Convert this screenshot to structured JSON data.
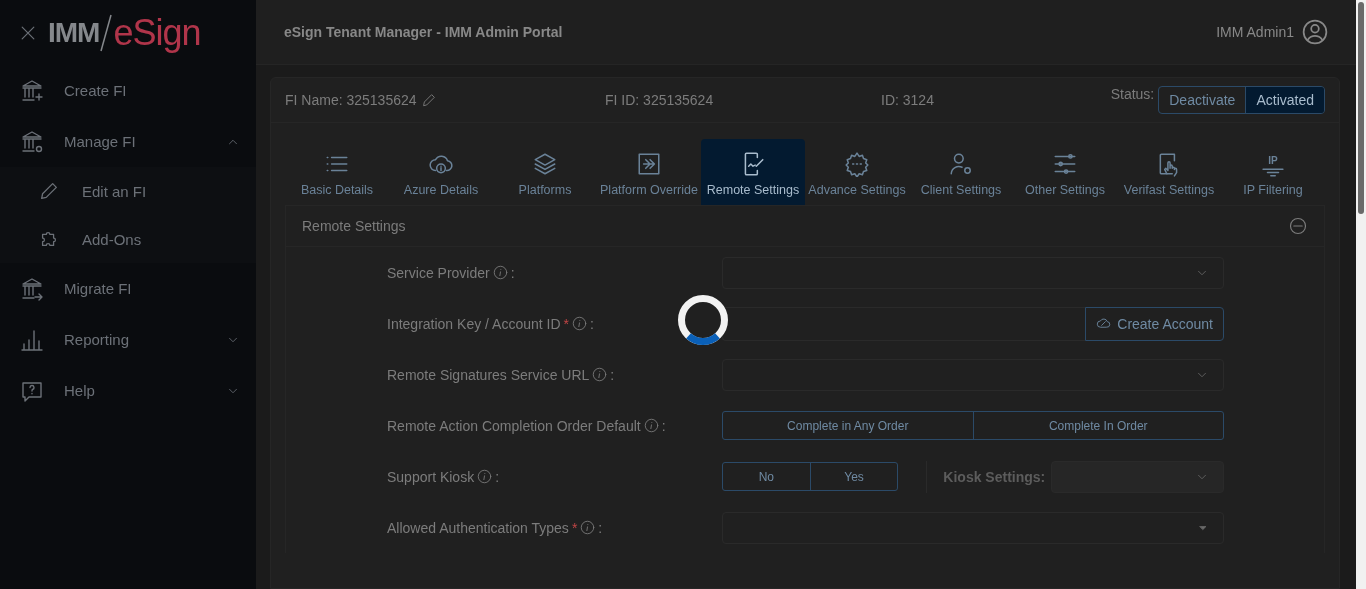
{
  "sidebar": {
    "logo": {
      "prefix": "IMM",
      "suffix": "eSign"
    },
    "items": [
      {
        "label": "Create FI",
        "kind": "link"
      },
      {
        "label": "Manage FI",
        "kind": "group",
        "expanded": true,
        "children": [
          {
            "label": "Edit an FI"
          },
          {
            "label": "Add-Ons"
          }
        ]
      },
      {
        "label": "Migrate FI",
        "kind": "link"
      },
      {
        "label": "Reporting",
        "kind": "group",
        "expanded": false
      },
      {
        "label": "Help",
        "kind": "group",
        "expanded": false
      }
    ]
  },
  "header": {
    "title": "eSign Tenant Manager - IMM Admin Portal",
    "user": "IMM Admin1"
  },
  "fi_info": {
    "fi_name": "FI Name: 325135624",
    "fi_id": "FI ID: 325135624",
    "id": "ID: 3124",
    "status_label": "Status:",
    "status_options": [
      {
        "label": "Deactivate",
        "selected": false
      },
      {
        "label": "Activated",
        "selected": true
      }
    ]
  },
  "tabs": [
    {
      "label": "Basic Details",
      "selected": false
    },
    {
      "label": "Azure Details",
      "selected": false
    },
    {
      "label": "Platforms",
      "selected": false
    },
    {
      "label": "Platform Override",
      "selected": false
    },
    {
      "label": "Remote Settings",
      "selected": true
    },
    {
      "label": "Advance Settings",
      "selected": false
    },
    {
      "label": "Client Settings",
      "selected": false
    },
    {
      "label": "Other Settings",
      "selected": false
    },
    {
      "label": "Verifast Settings",
      "selected": false
    },
    {
      "label": "IP Filtering",
      "selected": false,
      "icon_text": "IP"
    }
  ],
  "section": {
    "title": "Remote Settings",
    "expanded": true,
    "fields": [
      {
        "label": "Service Provider",
        "suffix": ":",
        "kind": "select"
      },
      {
        "label": "Integration Key / Account ID",
        "required_mark": "*",
        "suffix": ":",
        "kind": "input_button",
        "button": "Create Account"
      },
      {
        "label": "Remote Signatures Service URL",
        "suffix": ":",
        "kind": "select"
      },
      {
        "label": "Remote Action Completion Order Default",
        "suffix": ":",
        "kind": "toggle",
        "options": [
          {
            "label": "Complete in Any Order",
            "selected": false
          },
          {
            "label": "Complete In Order",
            "selected": false
          }
        ]
      },
      {
        "label": "Support Kiosk",
        "suffix": ":",
        "kind": "toggle",
        "options": [
          {
            "label": "No",
            "selected": false
          },
          {
            "label": "Yes",
            "selected": false
          }
        ],
        "extra": {
          "label": "Kiosk Settings:",
          "disabled": true
        }
      },
      {
        "label": "Allowed Authentication Types",
        "required_mark": "*",
        "suffix": ":",
        "kind": "multiselect"
      }
    ]
  },
  "loading": true
}
